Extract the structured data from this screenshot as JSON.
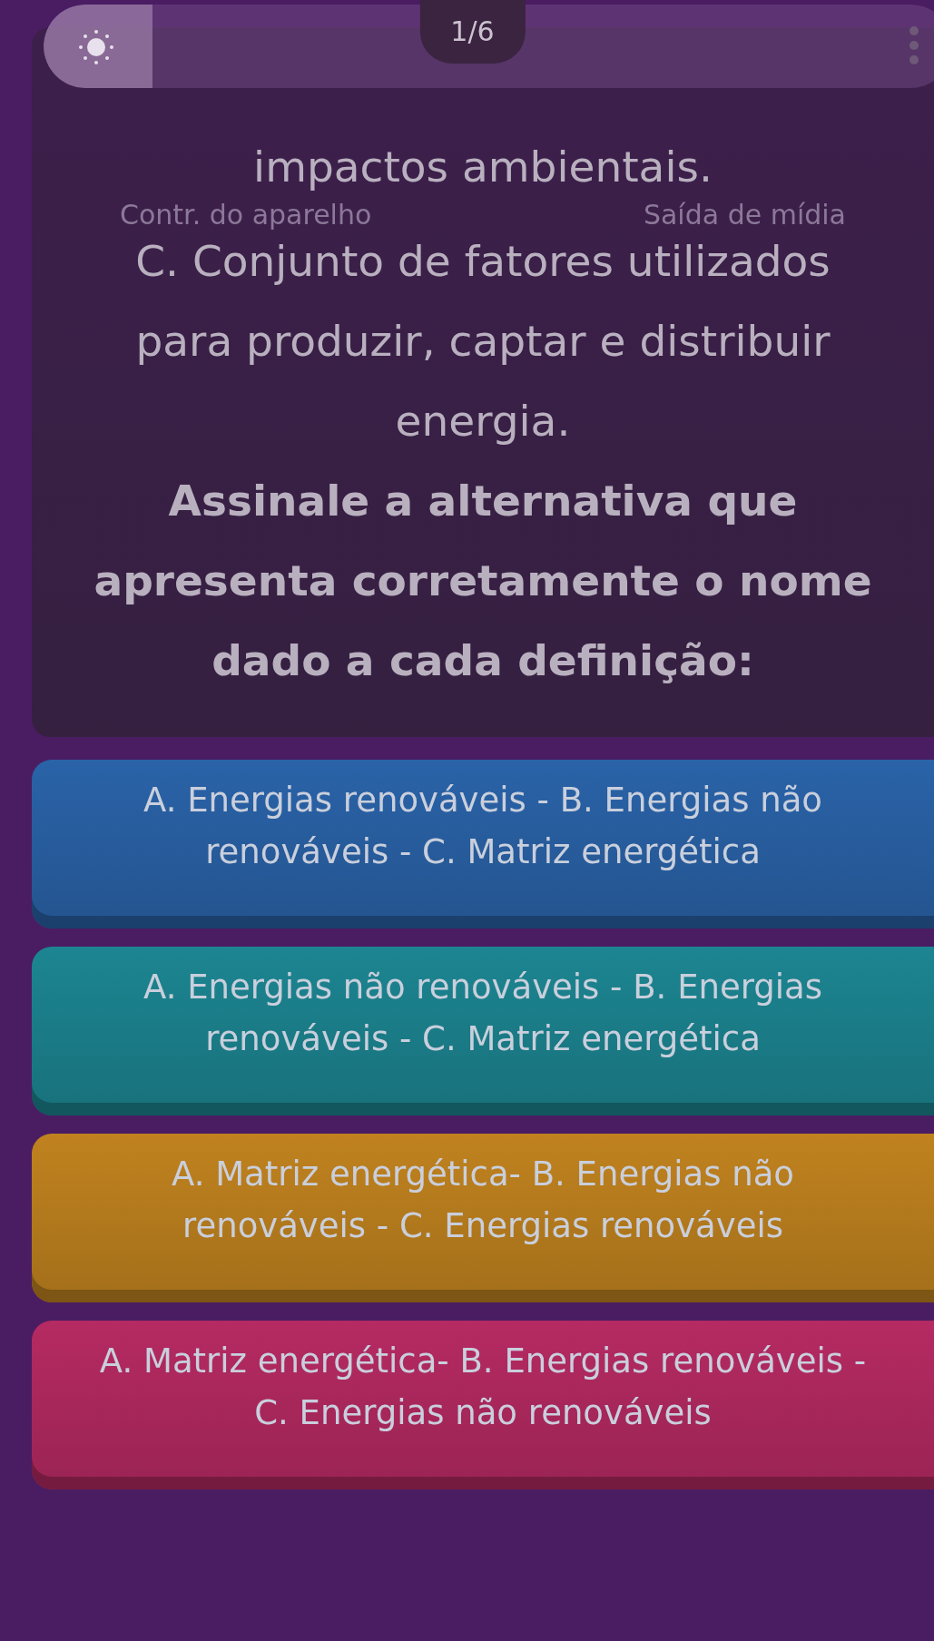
{
  "brightness_slider": {
    "level": 0.12
  },
  "counter": "1/6",
  "shade_labels": [
    "Contr. do aparelho",
    "Saída de mídia"
  ],
  "question": {
    "lines": [
      "impactos ambientais.",
      "C. Conjunto de fatores utilizados para produzir, captar e distribuir energia."
    ],
    "prompt": "Assinale a alternativa que apresenta corretamente o nome dado a cada definição:"
  },
  "options": [
    {
      "text": "A. Energias renováveis - B. Energias não renováveis - C. Matriz energética",
      "color": "#2a63a8"
    },
    {
      "text": "A. Energias não renováveis - B. Energias renováveis - C. Matriz energética",
      "color": "#1c8591"
    },
    {
      "text": "A. Matriz energética- B. Energias não renováveis - C. Energias renováveis",
      "color": "#c0821f"
    },
    {
      "text": "A. Matriz energética- B. Energias renováveis - C. Energias não renováveis",
      "color": "#b52a62"
    }
  ]
}
